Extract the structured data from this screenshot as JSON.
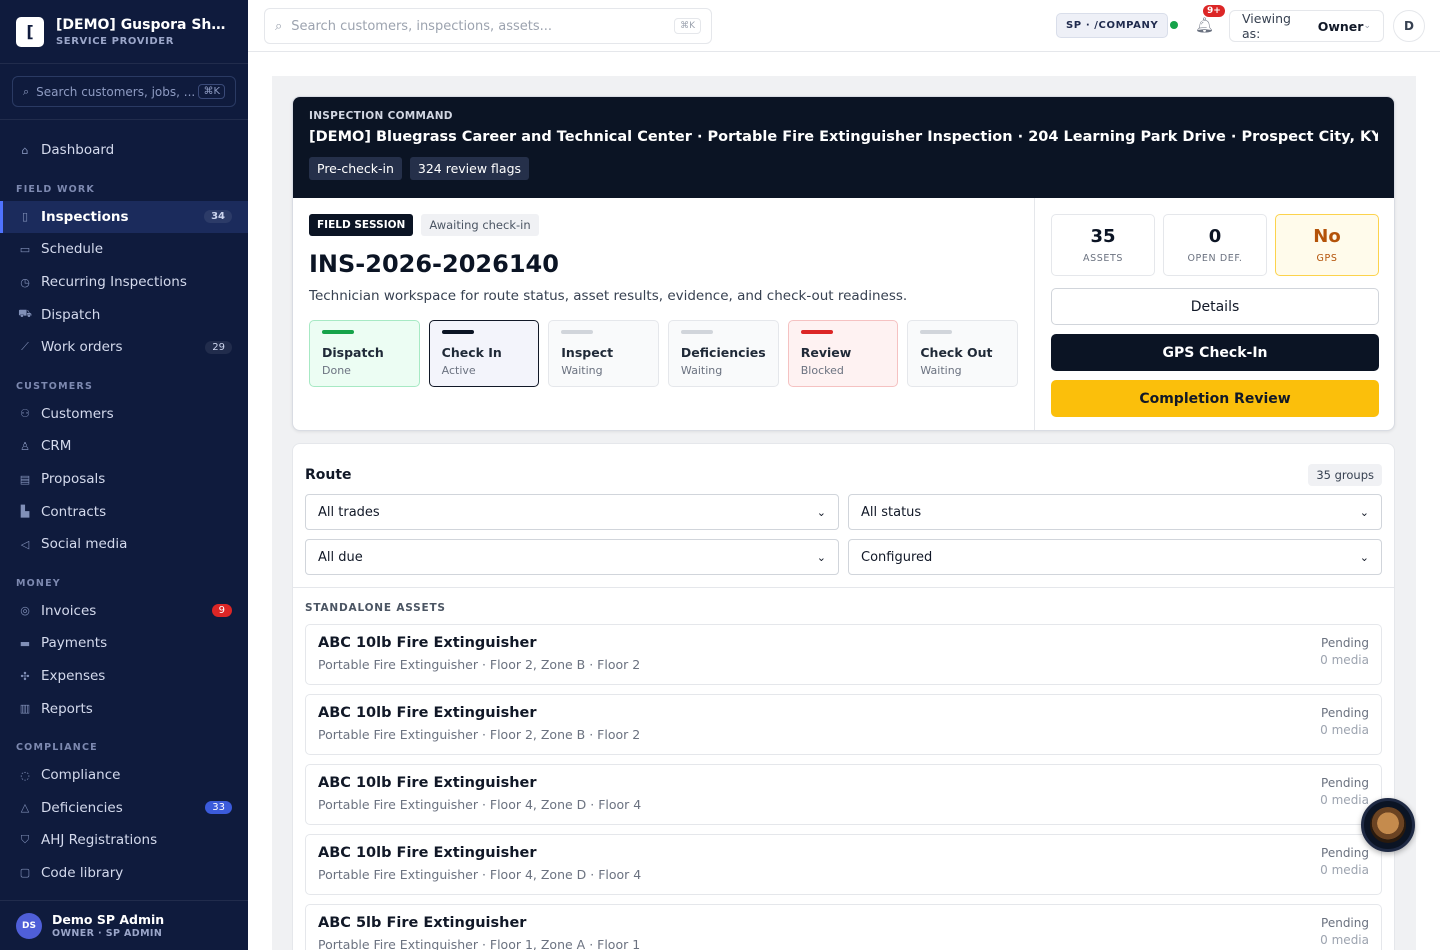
{
  "brand": {
    "title": "[DEMO] Guspora Show...",
    "subtitle": "SERVICE PROVIDER",
    "logo": "["
  },
  "sidebar": {
    "search_placeholder": "Search customers, jobs, ...",
    "search_kbd": "⌘K",
    "dashboard": "Dashboard",
    "sections": {
      "field_work": "FIELD WORK",
      "customers": "CUSTOMERS",
      "money": "MONEY",
      "compliance": "COMPLIANCE"
    },
    "field_work": [
      {
        "label": "Inspections",
        "badge": "34",
        "icon": "clipboard-icon"
      },
      {
        "label": "Schedule",
        "icon": "calendar-icon"
      },
      {
        "label": "Recurring Inspections",
        "icon": "repeat-icon"
      },
      {
        "label": "Dispatch",
        "icon": "truck-icon"
      },
      {
        "label": "Work orders",
        "badge": "29",
        "icon": "wrench-icon"
      }
    ],
    "customers": [
      {
        "label": "Customers",
        "icon": "users-icon"
      },
      {
        "label": "CRM",
        "icon": "user-icon"
      },
      {
        "label": "Proposals",
        "icon": "document-icon"
      },
      {
        "label": "Contracts",
        "icon": "file-icon"
      },
      {
        "label": "Social media",
        "icon": "megaphone-icon"
      }
    ],
    "money": [
      {
        "label": "Invoices",
        "badge": "9",
        "icon": "dollar-icon"
      },
      {
        "label": "Payments",
        "icon": "card-icon"
      },
      {
        "label": "Expenses",
        "icon": "receipt-icon"
      },
      {
        "label": "Reports",
        "icon": "chart-icon"
      }
    ],
    "compliance": [
      {
        "label": "Compliance",
        "icon": "check-circle-icon"
      },
      {
        "label": "Deficiencies",
        "badge": "33",
        "icon": "warning-icon"
      },
      {
        "label": "AHJ Registrations",
        "icon": "shield-icon"
      },
      {
        "label": "Code library",
        "icon": "book-icon"
      }
    ],
    "user": {
      "initials": "DS",
      "name": "Demo SP Admin",
      "role": "OWNER · SP ADMIN"
    }
  },
  "topbar": {
    "search_placeholder": "Search customers, inspections, assets...",
    "search_kbd": "⌘K",
    "tenant": "SP · /COMPANY",
    "notifications": "9+",
    "viewing_label": "Viewing as:",
    "viewing_value": "Owner",
    "avatar": "D"
  },
  "command": {
    "eyebrow": "INSPECTION COMMAND",
    "title": "[DEMO] Bluegrass Career and Technical Center · Portable Fire Extinguisher Inspection · 204 Learning Park Drive · Prospect City, KY",
    "tags": [
      "Pre-check-in",
      "324 review flags"
    ]
  },
  "session": {
    "badge": "FIELD SESSION",
    "state": "Awaiting check-in",
    "id": "INS-2026-2026140",
    "description": "Technician workspace for route status, asset results, evidence, and check-out readiness.",
    "steps": [
      {
        "name": "Dispatch",
        "status": "Done",
        "kind": "done"
      },
      {
        "name": "Check In",
        "status": "Active",
        "kind": "active"
      },
      {
        "name": "Inspect",
        "status": "Waiting",
        "kind": "waiting"
      },
      {
        "name": "Deficiencies",
        "status": "Waiting",
        "kind": "waiting"
      },
      {
        "name": "Review",
        "status": "Blocked",
        "kind": "blocked"
      },
      {
        "name": "Check Out",
        "status": "Waiting",
        "kind": "waiting"
      }
    ],
    "stats": [
      {
        "value": "35",
        "label": "ASSETS"
      },
      {
        "value": "0",
        "label": "OPEN DEF."
      },
      {
        "value": "No",
        "label": "GPS"
      }
    ],
    "buttons": {
      "details": "Details",
      "gps": "GPS Check-In",
      "completion": "Completion Review"
    }
  },
  "route": {
    "title": "Route",
    "groups": "35 groups",
    "filters": [
      "All trades",
      "All status",
      "All due",
      "Configured"
    ],
    "section": "STANDALONE ASSETS",
    "assets": [
      {
        "name": "ABC 10lb Fire Extinguisher",
        "location": "Portable Fire Extinguisher · Floor 2, Zone B · Floor 2",
        "status": "Pending",
        "media": "0 media"
      },
      {
        "name": "ABC 10lb Fire Extinguisher",
        "location": "Portable Fire Extinguisher · Floor 2, Zone B · Floor 2",
        "status": "Pending",
        "media": "0 media"
      },
      {
        "name": "ABC 10lb Fire Extinguisher",
        "location": "Portable Fire Extinguisher · Floor 4, Zone D · Floor 4",
        "status": "Pending",
        "media": "0 media"
      },
      {
        "name": "ABC 10lb Fire Extinguisher",
        "location": "Portable Fire Extinguisher · Floor 4, Zone D · Floor 4",
        "status": "Pending",
        "media": "0 media"
      },
      {
        "name": "ABC 5lb Fire Extinguisher",
        "location": "Portable Fire Extinguisher · Floor 1, Zone A · Floor 1",
        "status": "Pending",
        "media": "0 media"
      }
    ]
  }
}
